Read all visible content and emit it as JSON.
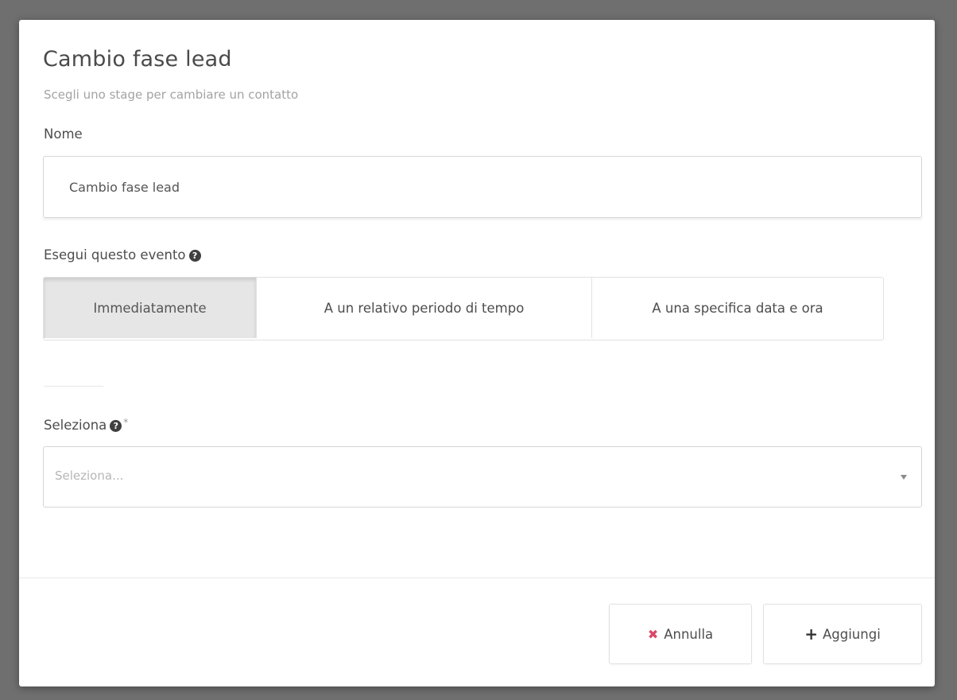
{
  "dialog": {
    "title": "Cambio fase lead",
    "subtitle": "Scegli uno stage per cambiare un contatto"
  },
  "name_field": {
    "label": "Nome",
    "value": "Cambio fase lead"
  },
  "trigger": {
    "label": "Esegui questo evento",
    "help_icon": "question-circle-icon",
    "options": [
      {
        "label": "Immediatamente",
        "active": true
      },
      {
        "label": "A un relativo periodo di tempo",
        "active": false
      },
      {
        "label": "A una specifica data e ora",
        "active": false
      }
    ]
  },
  "stage_select": {
    "label": "Seleziona",
    "required_mark": "*",
    "help_icon": "question-circle-icon",
    "placeholder": "Seleziona..."
  },
  "footer": {
    "cancel_label": "Annulla",
    "cancel_icon": "times-icon",
    "cancel_icon_color": "#d9486a",
    "add_label": "Aggiungi",
    "add_icon": "plus-icon"
  }
}
